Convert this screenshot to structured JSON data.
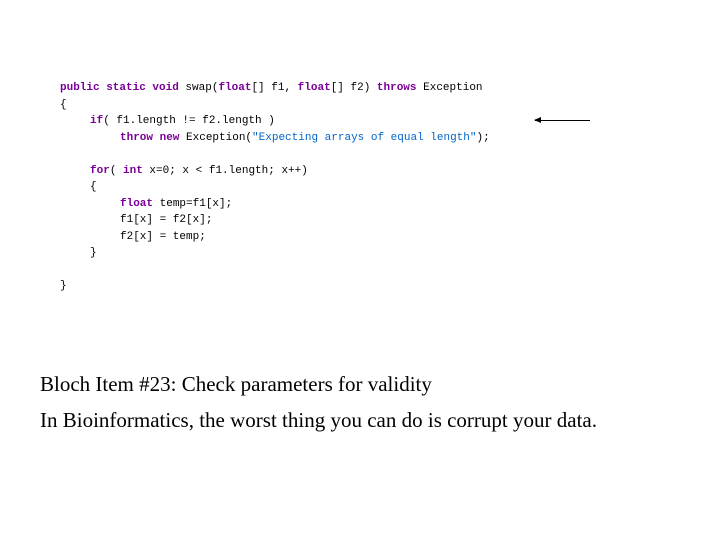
{
  "code": {
    "l1a": "public static void",
    "l1b": " swap(",
    "l1c": "float",
    "l1d": "[] f1, ",
    "l1e": "float",
    "l1f": "[] f2) ",
    "l1g": "throws",
    "l1h": " Exception",
    "l2": "{",
    "l3a": "if",
    "l3b": "( f1.length != f2.length )",
    "l4a": "throw new",
    "l4b": " Exception(",
    "l4c": "\"Expecting arrays of equal length\"",
    "l4d": ");",
    "l5a": "for",
    "l5b": "( ",
    "l5c": "int",
    "l5d": " x=0; x < f1.length; x++)",
    "l6": "{",
    "l7a": "float",
    "l7b": " temp=f1[x];",
    "l8": "f1[x] = f2[x];",
    "l9": "f2[x] = temp;",
    "l10": "}",
    "l11": "}"
  },
  "caption": {
    "line1": "Bloch Item #23: Check parameters for validity",
    "line2": "In Bioinformatics, the worst thing you can do is corrupt your data."
  }
}
